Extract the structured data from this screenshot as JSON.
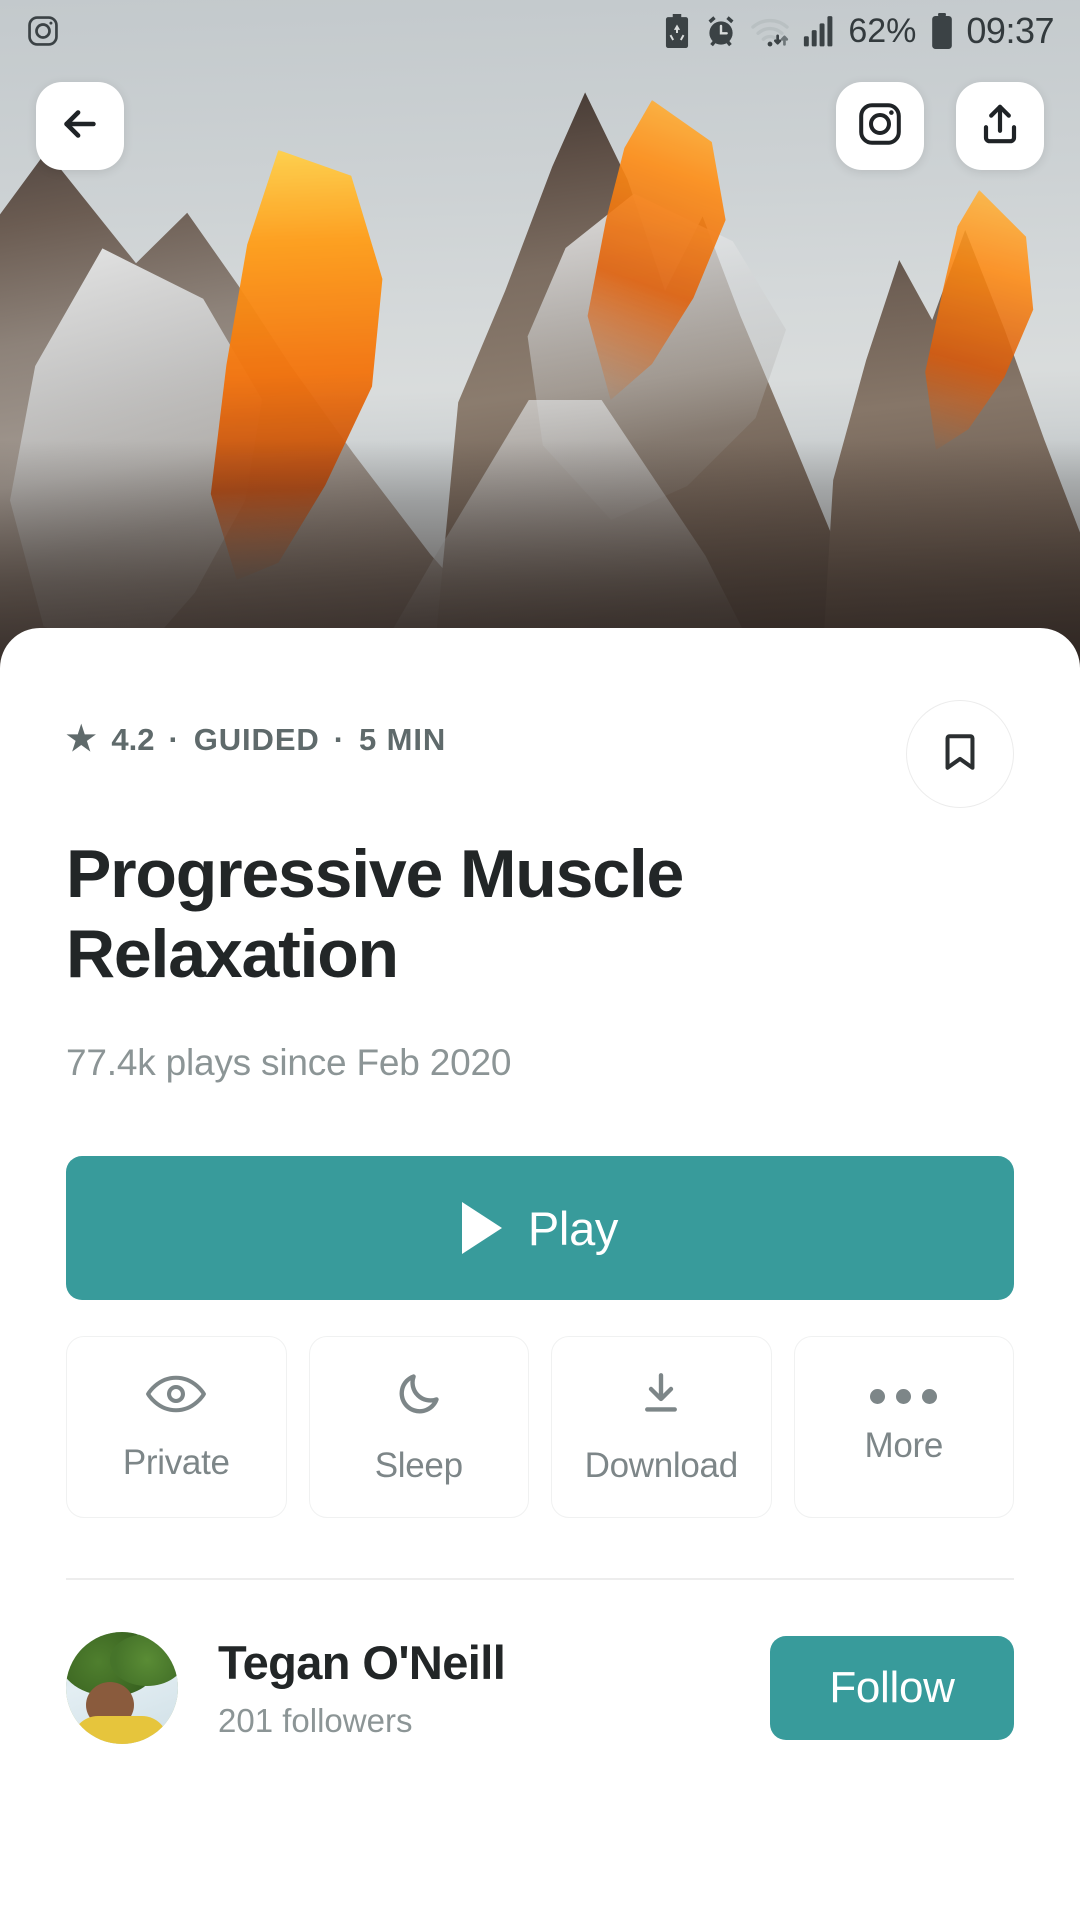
{
  "status_bar": {
    "notification_icon": "instagram-icon",
    "icons": [
      "battery-saver-icon",
      "alarm-icon",
      "wifi-icon",
      "signal-icon"
    ],
    "battery_percent": "62%",
    "battery_icon": "battery-icon",
    "time": "09:37"
  },
  "top_nav": {
    "back_label": "back-arrow-icon",
    "instagram_label": "instagram-icon",
    "share_label": "share-upload-icon"
  },
  "hero": {
    "alt": "sunlit mountain peaks at sunrise"
  },
  "content": {
    "rating": "4.2",
    "sep1": "·",
    "type": "GUIDED",
    "sep2": "·",
    "duration": "5 MIN",
    "star": "★",
    "title": "Progressive Muscle Relaxation",
    "subtitle": "77.4k plays since Feb 2020",
    "bookmark_icon": "bookmark-icon"
  },
  "play": {
    "label": "Play",
    "icon": "play-triangle-icon",
    "color": "#389b9b"
  },
  "actions": [
    {
      "label": "Private",
      "icon": "eye-icon"
    },
    {
      "label": "Sleep",
      "icon": "moon-icon"
    },
    {
      "label": "Download",
      "icon": "download-icon"
    },
    {
      "label": "More",
      "icon": "ellipsis-icon"
    }
  ],
  "author": {
    "name": "Tegan O'Neill",
    "followers": "201 followers",
    "follow_label": "Follow",
    "avatar": "author-avatar"
  },
  "colors": {
    "accent": "#389b9b",
    "title": "#222627",
    "muted": "#8c9596",
    "meta": "#5f6a6b",
    "border": "#f0f1f1"
  }
}
